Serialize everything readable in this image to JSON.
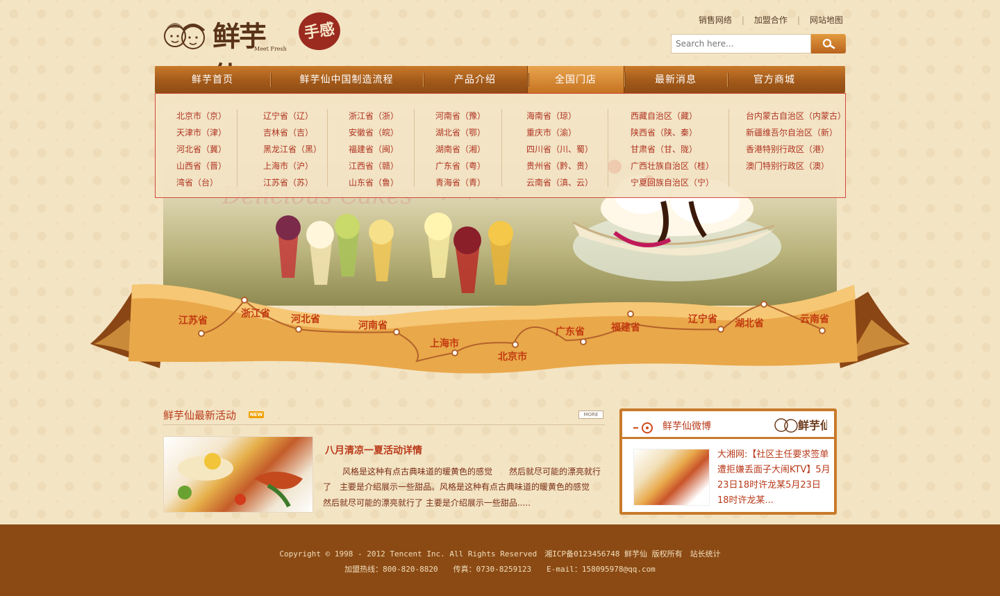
{
  "header": {
    "brand": "鲜芋仙",
    "brand_sub": "Meet Fresh",
    "stamp": "手感",
    "top_links": [
      "销售网络",
      "加盟合作",
      "网站地图"
    ],
    "search_placeholder": "Search here..."
  },
  "nav": {
    "items": [
      {
        "label": "鲜芋首页"
      },
      {
        "label": "鲜芋仙中国制造流程"
      },
      {
        "label": "产品介绍"
      },
      {
        "label": "全国门店",
        "active": true
      },
      {
        "label": "最新消息"
      },
      {
        "label": "官方商城"
      }
    ]
  },
  "dropdown": {
    "columns": [
      [
        "北京市（京）",
        "天津市（津）",
        "河北省（冀）",
        "山西省（晋）",
        "湾省（台）"
      ],
      [
        "辽宁省（辽）",
        "吉林省（吉）",
        "黑龙江省（黑）",
        "上海市（沪）",
        "江苏省（苏）"
      ],
      [
        "浙江省（浙）",
        "安徽省（皖）",
        "福建省（闽）",
        "江西省（赣）",
        "山东省（鲁）"
      ],
      [
        "河南省（豫）",
        "湖北省（鄂）",
        "湖南省（湘）",
        "广东省（粤）",
        "青海省（青）"
      ],
      [
        "海南省（琼）",
        "重庆市（渝）",
        "四川省（川、蜀）",
        "贵州省（黔、贵）",
        "云南省（滇、云）"
      ],
      [
        "西藏自治区（藏）",
        "陕西省（陕、秦）",
        "甘肃省（甘、陇）",
        "广西壮族自治区（桂）",
        "宁夏回族自治区（宁）"
      ],
      [
        "台内蒙古自治区（内蒙古）",
        "新疆维吾尔自治区（新）",
        "香港特别行政区（港）",
        "澳门特别行政区（澳）"
      ]
    ]
  },
  "banner": {
    "script_text": "Delicious Cakes",
    "script_sub": "make your life tasty",
    "route": [
      "江苏省",
      "浙江省",
      "河北省",
      "河南省",
      "上海市",
      "北京市",
      "广东省",
      "福建省",
      "辽宁省",
      "湖北省",
      "云南省"
    ]
  },
  "news": {
    "section_title": "鲜芋仙最新活动",
    "new_badge": "NEW",
    "more_label": "MORE",
    "item_title": "八月清凉一夏活动详情",
    "item_body": "风格是这种有点古典味道的暖黄色的感觉　　然后就尽可能的漂亮就行了　主要是介绍展示一些甜品。风格是这种有点古典味道的暖黄色的感觉　　然后就尽可能的漂亮就行了 主要是介绍展示一些甜品....."
  },
  "weibo": {
    "title": "鲜芋仙微博",
    "text": "大湘网:【社区主任要求签单遭拒嫌丢面子大闹KTV】5月23日18时许龙某5月23日18时许龙某..."
  },
  "footer": {
    "line1": "Copyright © 1998 - 2012 Tencent Inc. All Rights Reserved　湘ICP备0123456748 鲜芋仙 版权所有　站长统计",
    "line2": "加盟热线：800-820-8820　　传真：0730-8259123　　E-mail：158095978@qq.com"
  }
}
